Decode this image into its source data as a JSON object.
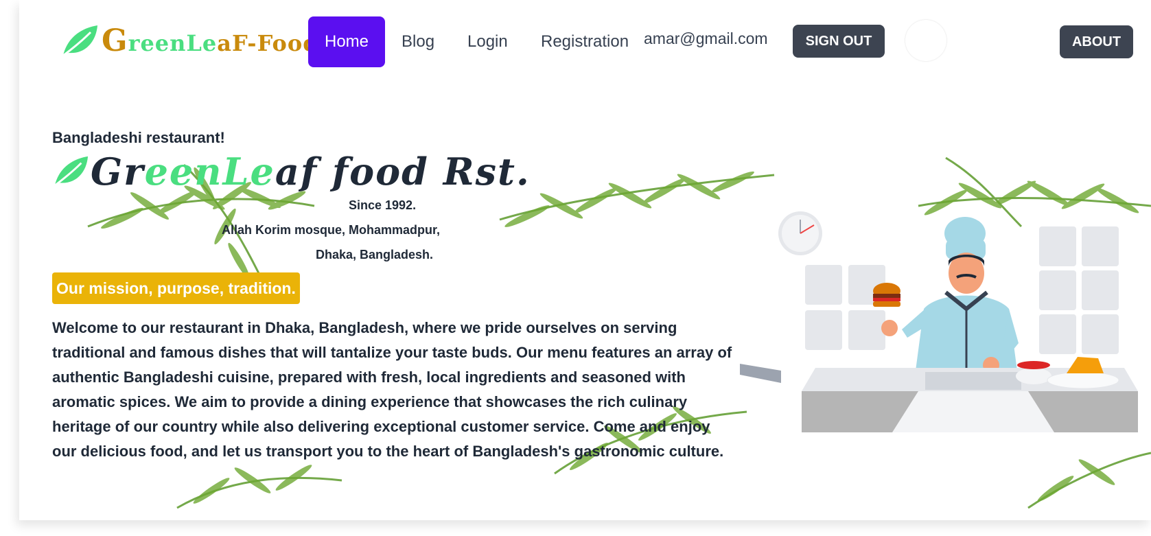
{
  "brand": {
    "logo_text_first": "G",
    "logo_text_mid": "reenLe",
    "logo_text_rest": "aF-Food"
  },
  "nav": {
    "home": "Home",
    "blog": "Blog",
    "login": "Login",
    "registration": "Registration",
    "user_email": "amar@gmail.com",
    "sign_out": "SIGN OUT",
    "about": "ABOUT"
  },
  "hero": {
    "tagline": "Bangladeshi restaurant!",
    "title_part1": "Gr",
    "title_part2": "eenLe",
    "title_part3": "af food Rst.",
    "since": "Since 1992.",
    "address_line1": "Allah Korim mosque, Mohammadpur,",
    "address_line2": "Dhaka, Bangladesh.",
    "mission_badge": "Our mission, purpose, tradition.",
    "description": "Welcome to our restaurant in Dhaka, Bangladesh, where we pride ourselves on serving traditional and famous dishes that will tantalize your taste buds. Our menu features an array of authentic Bangladeshi cuisine, prepared with fresh, local ingredients and seasoned with aromatic spices. We aim to provide a dining experience that showcases the rich culinary heritage of our country while also delivering exceptional customer service. Come and enjoy our delicious food, and let us transport you to the heart of Bangladesh's gastronomic culture."
  },
  "colors": {
    "primary_nav": "#5b0ff0",
    "dark_button": "#3d4451",
    "accent_green": "#4ade80",
    "accent_gold": "#eab308",
    "logo_gold": "#c98a0c"
  },
  "icons": [
    "leaf-icon",
    "chef-illustration",
    "clock-icon",
    "burger-icon"
  ]
}
